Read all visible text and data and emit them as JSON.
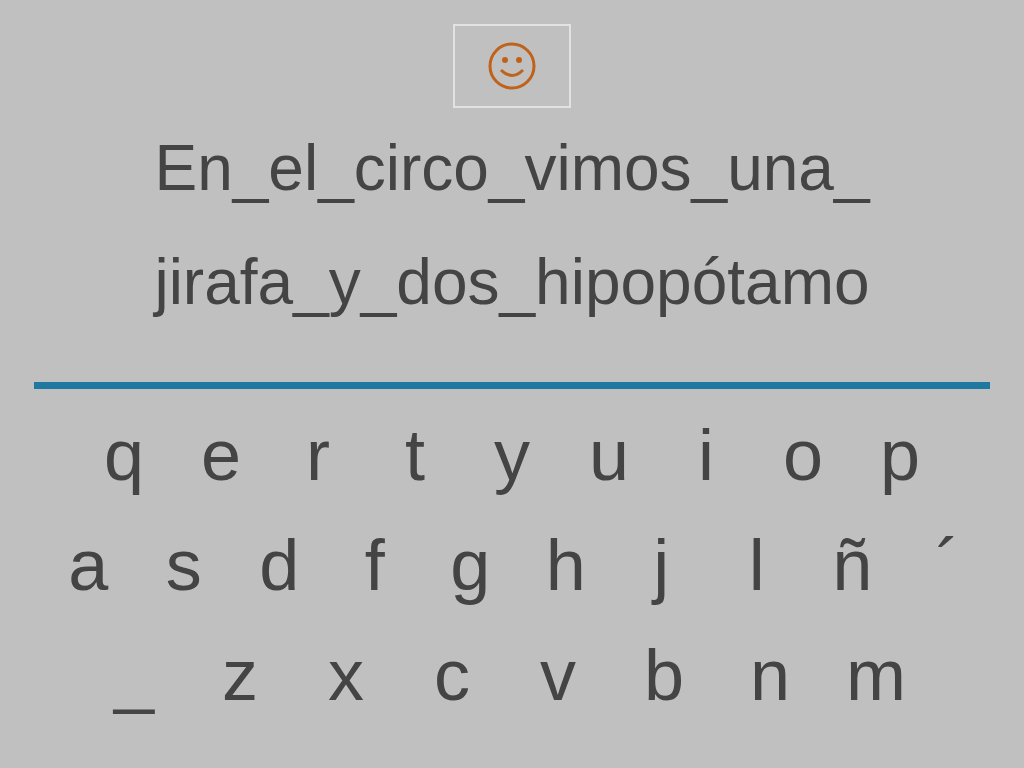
{
  "sentence_lines": [
    "En_el_circo_vimos_una_",
    "jirafa_y_dos_hipopótamo"
  ],
  "keyboard_rows": [
    [
      "q",
      "e",
      "r",
      "t",
      "y",
      "u",
      "i",
      "o",
      "p"
    ],
    [
      "a",
      "s",
      "d",
      "f",
      "g",
      "h",
      "j",
      "l",
      "ñ",
      "´"
    ],
    [
      "_",
      "z",
      "x",
      "c",
      "v",
      "b",
      "n",
      "m"
    ]
  ]
}
